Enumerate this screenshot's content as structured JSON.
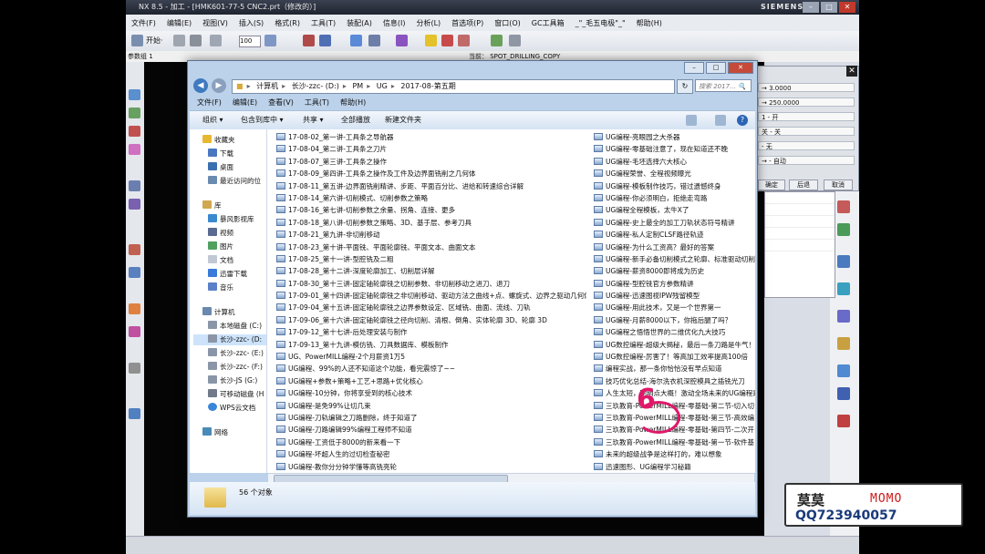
{
  "nx": {
    "title": "NX 8.5 - 加工 - [HMK601-77-5 CNC2.prt（修改的）]",
    "brand": "SIEMENS",
    "menu": [
      "文件(F)",
      "编辑(E)",
      "视图(V)",
      "插入(S)",
      "格式(R)",
      "工具(T)",
      "装配(A)",
      "信息(I)",
      "分析(L)",
      "首选项(P)",
      "窗口(O)",
      "GC工具箱",
      "_\"_毛五电极\"_\"",
      "帮助(H)"
    ],
    "start_label": "开始·",
    "zoom_value": "100",
    "param_label": "参数组 1",
    "current_label": "当前： SPOT_DRILLING_COPY",
    "dialog_rows": [
      "→ 3.0000",
      "→ 250.0000",
      "1 - 开",
      "关 - 关",
      "- 无",
      "→ - 自动"
    ],
    "dialog_buttons": [
      "确定",
      "后退",
      "取消"
    ]
  },
  "explorer": {
    "controls": {
      "minimize": "–",
      "maximize": "□",
      "close": "✕"
    },
    "back": "◀",
    "forward": "▶",
    "address": [
      "计算机",
      "长沙-zzc- (D:)",
      "PM",
      "UG",
      "2017-08-第五期"
    ],
    "refresh": "↻",
    "search_placeholder": "搜索 2017... 🔍",
    "menu": [
      "文件(F)",
      "编辑(E)",
      "查看(V)",
      "工具(T)",
      "帮助(H)"
    ],
    "toolbar": [
      "组织 ▾",
      "包含到库中 ▾",
      "共享 ▾",
      "全部播放",
      "新建文件夹"
    ],
    "help": "?",
    "nav": {
      "favorites": [
        "收藏夹",
        "下载",
        "桌面",
        "最近访问的位"
      ],
      "library": [
        "库",
        "暴风影视库",
        "视频",
        "图片",
        "文档",
        "迅雷下载",
        "音乐"
      ],
      "computer": [
        "计算机",
        "本地磁盘 (C:)",
        "长沙-zzc- (D:",
        "长沙-zzc- (E:)",
        "长沙-zzc- (F:)",
        "长沙-JS (G:)",
        "可移动磁盘 (H",
        "WPS云文档"
      ],
      "network": "网络"
    },
    "files_left": [
      "17-08-02_第一讲-工具条之导航器",
      "17-08-04_第二讲-工具条之刀片",
      "17-08-07_第三讲-工具条之操作",
      "17-08-09_第四讲-工具条之操作及工件及边界面铣削之几何体",
      "17-08-11_第五讲-边界面铣削精讲、步距、平面百分比、进给和转速综合详解",
      "17-08-14_第六讲-切削模式、切削参数之策略",
      "17-08-16_第七讲-切削参数之余量、拐角、连接、更多",
      "17-08-18_第八讲-切削参数之策略、3D、基于层、参考刀具",
      "17-08-21_第九讲-非切削移动",
      "17-08-23_第十讲-平面铣、平面轮廓铣、平面文本、曲面文本",
      "17-08-25_第十一讲-型腔铣及二粗",
      "17-08-28_第十二讲-深度轮廓加工、切削层详解",
      "17-08-30_第十三讲-固定轴轮廓铣之切削参数、非切削移动之进刀、退刀",
      "17-09-01_第十四讲-固定轴轮廓铣之非切削移动、驱动方法之曲线+点、螺旋式、边界之驱动几何体",
      "17-09-04_第十五讲-固定轴轮廓铣之边界参数设定、区域铣、曲面、流线、刀轨",
      "17-09-06_第十六讲-固定轴轮廓铣之径向切削、清根、倒角、实体轮廓 3D、轮廓 3D",
      "17-09-12_第十七讲-后处理安装与制作",
      "17-09-13_第十九讲-模仿铣、刀具数据库、模板制作",
      "UG、PowerMILL编程-2个月薪资1万5",
      "UG编程、99%的人还不知道这个功能，看完震惊了~~",
      "UG编程+参数+策略+工艺+思路+优化核心",
      "UG编程-10分钟，你将享受到的核心技术",
      "UG编程-是免99%让切几束",
      "UG编程-刀轨编辑之刀路删除，终于知道了",
      "UG编程-刀路编辑99%编程工程师不知道",
      "UG编程-工资低于8000的新来看一下",
      "UG编程-坏超人生的过切检查秘密",
      "UG编程-教你分分钟学懂等高铣亮轮"
    ],
    "files_right": [
      "UG编程-亮眼园之大杀器",
      "UG编程-零基础注意了，现在知道还不晚",
      "UG编程-毛坯选择六大核心",
      "UG编程荣誉、全程视频曝光",
      "UG编程-模板制作技巧，错过遗憾终身",
      "UG编程-你必须明白，拒绝走弯路",
      "UG编程全程模板，太牛X了",
      "UG编程-史上最全的加工刀轨状态符号精讲",
      "UG编程-私人定制CLSF路径轨迹",
      "UG编程-为什么工资高？最好的答案",
      "UG编程-新手必备切削模式之轮廓、标准驱动切削",
      "UG编程-薪资8000即将成为历史",
      "UG编程-型腔铣官方参数精讲",
      "UG编程-迅速图视IPW残留模型",
      "UG编程-用此技术，又是一个世界第一",
      "UG编程-月薪8000以下，你拖后腿了吗？",
      "UG编程之悟悟世界的二维优化九大技巧",
      "UG数控编程-超级大揭秘，最后一条刀路是牛气！",
      "UG数控编程-厉害了！等高加工效率提高100倍",
      "编程实战，那一条你恰恰没有早点知道",
      "技巧优化总结-海尔洗衣机深腔模具之插铣光刀",
      "人生太短，聪明点大概！激动全场未来的UG编程是",
      "三玖教育-PowerMILL编程-零基础-第二节-切入切",
      "三玖教育-PowerMILL编程-零基础-第三节-高效编",
      "三玖教育-PowerMILL编程-零基础-第四节-二次开",
      "三玖教育-PowerMILL编程-零基础-第一节-软件基",
      "未来的超级战争是这样打的，难以想象",
      "迅速图形、UG编程学习秘籍"
    ],
    "status_text": "56 个对象"
  },
  "annotation": {
    "number": "6"
  },
  "logo": {
    "name_cn": "莫莫",
    "name_en": "MOMO",
    "qq": "QQ723940057"
  },
  "colors": {
    "accent": "#3f7ac0",
    "mark": "#e0186a",
    "titlebar": "#1f2430"
  }
}
